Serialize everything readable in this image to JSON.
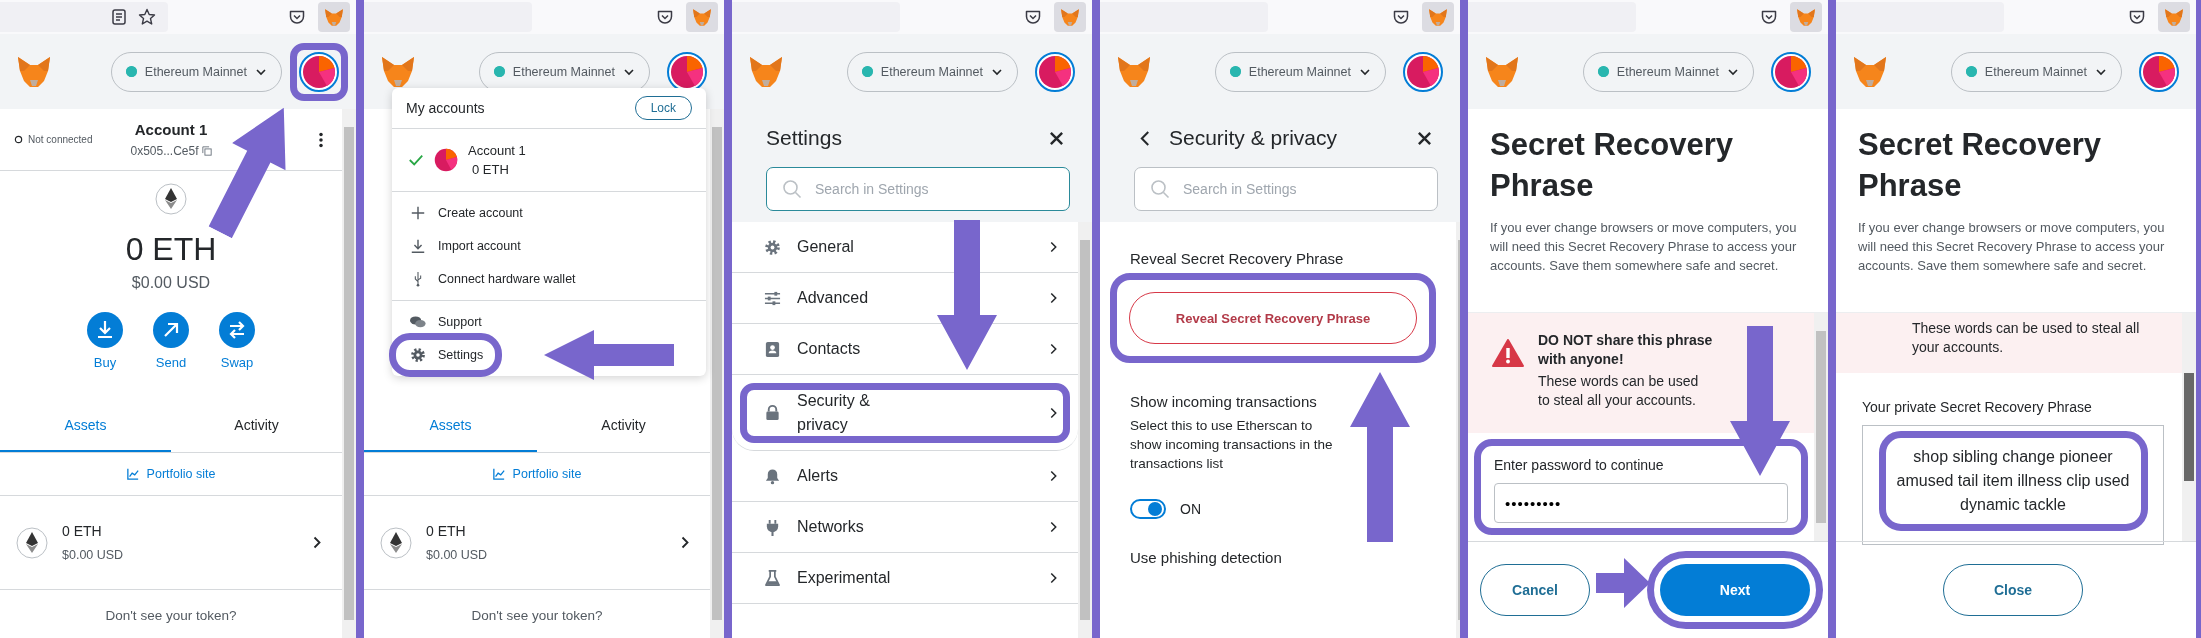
{
  "panels": [
    {
      "kind": "wallet",
      "network": "Ethereum Mainnet",
      "avatar_highlighted": true,
      "connection": "Not connected",
      "account": "Account 1",
      "address": "0x505...Ce5f",
      "balance": "0 ETH",
      "balance_usd": "$0.00 USD",
      "actions": [
        {
          "kind": "buy",
          "label": "Buy"
        },
        {
          "kind": "send",
          "label": "Send"
        },
        {
          "kind": "swap",
          "label": "Swap"
        }
      ],
      "tabs": [
        {
          "label": "Assets",
          "selected": true
        },
        {
          "label": "Activity",
          "selected": false
        }
      ],
      "portfolio_link": "Portfolio site",
      "assets": [
        {
          "amount": "0 ETH",
          "value": "$0.00 USD"
        }
      ],
      "token_prompt": "Don't see your token?"
    },
    {
      "kind": "menu",
      "network": "Ethereum Mainnet",
      "avatar_highlighted": false,
      "menu": {
        "title": "My accounts",
        "lock": "Lock",
        "accounts": [
          {
            "name": "Account 1",
            "balance": "0 ETH",
            "selected": true
          }
        ],
        "groups": [
          [
            {
              "kind": "create",
              "label": "Create account",
              "highlighted": false
            },
            {
              "kind": "import",
              "label": "Import account",
              "highlighted": false
            },
            {
              "kind": "hardware",
              "label": "Connect hardware wallet",
              "highlighted": false
            }
          ],
          [
            {
              "kind": "support",
              "label": "Support",
              "highlighted": false
            },
            {
              "kind": "settings",
              "label": "Settings",
              "highlighted": true
            }
          ]
        ]
      },
      "tabs": [
        {
          "label": "Assets",
          "selected": true
        },
        {
          "label": "Activity",
          "selected": false
        }
      ],
      "portfolio_link": "Portfolio site",
      "assets": [
        {
          "amount": "0 ETH",
          "value": "$0.00 USD"
        }
      ],
      "token_prompt": "Don't see your token?"
    },
    {
      "kind": "settings",
      "network": "Ethereum Mainnet",
      "avatar_highlighted": false,
      "title": "Settings",
      "search": {
        "placeholder": "Search in Settings",
        "focused": true
      },
      "items": [
        {
          "kind": "general",
          "label": "General",
          "highlighted": false
        },
        {
          "kind": "advanced",
          "label": "Advanced",
          "highlighted": false
        },
        {
          "kind": "contacts",
          "label": "Contacts",
          "highlighted": false
        },
        {
          "kind": "security",
          "label": "Security & privacy",
          "highlighted": true
        },
        {
          "kind": "alerts",
          "label": "Alerts",
          "highlighted": false
        },
        {
          "kind": "networks",
          "label": "Networks",
          "highlighted": false
        },
        {
          "kind": "experimental",
          "label": "Experimental",
          "highlighted": false
        }
      ]
    },
    {
      "kind": "security",
      "network": "Ethereum Mainnet",
      "avatar_highlighted": false,
      "title": "Security & privacy",
      "search": {
        "placeholder": "Search in Settings",
        "focused": false
      },
      "sections": [
        {
          "kind": "button",
          "heading": "Reveal Secret Recovery Phrase",
          "button": "Reveal Secret Recovery Phrase",
          "highlighted": true
        },
        {
          "kind": "toggle",
          "heading": "Show incoming transactions",
          "description": "Select this to use Etherscan to show incoming transactions in the transactions list",
          "on": true,
          "state_label": "ON"
        },
        {
          "kind": "heading",
          "heading": "Use phishing detection"
        }
      ]
    },
    {
      "kind": "reveal",
      "network": "Ethereum Mainnet",
      "avatar_highlighted": false,
      "title": "Secret Recovery Phrase",
      "intro": "If you ever change browsers or move computers, you will need this Secret Recovery Phrase to access your accounts. Save them somewhere safe and secret.",
      "warning": {
        "title": "DO NOT share this phrase with anyone!",
        "text": "These words can be used to steal all your accounts."
      },
      "password": {
        "label": "Enter password to continue",
        "value": "•••••••••",
        "highlighted": true
      },
      "buttons": [
        {
          "kind": "secondary",
          "label": "Cancel",
          "highlighted": false
        },
        {
          "kind": "primary",
          "label": "Next",
          "highlighted": true
        }
      ]
    },
    {
      "kind": "phrase",
      "network": "Ethereum Mainnet",
      "avatar_highlighted": false,
      "title": "Secret Recovery Phrase",
      "intro": "If you ever change browsers or move computers, you will need this Secret Recovery Phrase to access your accounts. Save them somewhere safe and secret.",
      "warning": {
        "text": "These words can be used to steal all your accounts."
      },
      "phrase": {
        "label": "Your private Secret Recovery Phrase",
        "words": "shop sibling change pioneer amused tail item illness clip used dynamic tackle",
        "highlighted": true
      },
      "buttons": [
        {
          "kind": "secondary",
          "label": "Close",
          "highlighted": false
        }
      ]
    }
  ]
}
